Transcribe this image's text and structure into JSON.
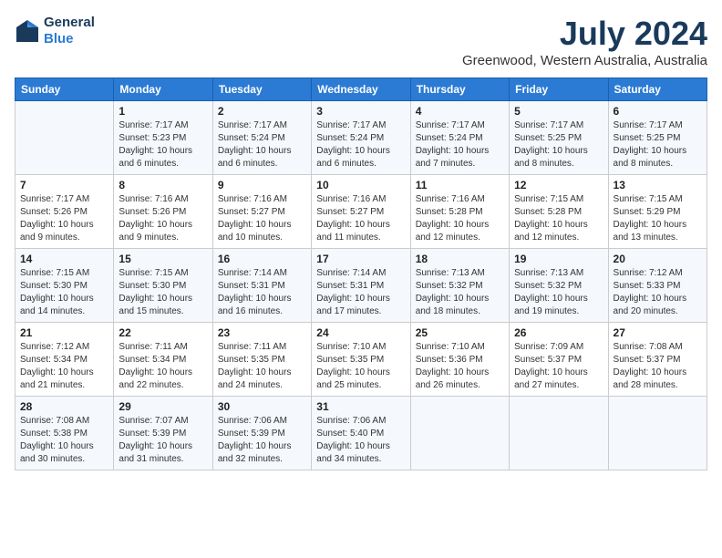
{
  "header": {
    "logo_line1": "General",
    "logo_line2": "Blue",
    "month": "July 2024",
    "location": "Greenwood, Western Australia, Australia"
  },
  "weekdays": [
    "Sunday",
    "Monday",
    "Tuesday",
    "Wednesday",
    "Thursday",
    "Friday",
    "Saturday"
  ],
  "weeks": [
    [
      {
        "day": "",
        "info": ""
      },
      {
        "day": "1",
        "info": "Sunrise: 7:17 AM\nSunset: 5:23 PM\nDaylight: 10 hours\nand 6 minutes."
      },
      {
        "day": "2",
        "info": "Sunrise: 7:17 AM\nSunset: 5:24 PM\nDaylight: 10 hours\nand 6 minutes."
      },
      {
        "day": "3",
        "info": "Sunrise: 7:17 AM\nSunset: 5:24 PM\nDaylight: 10 hours\nand 6 minutes."
      },
      {
        "day": "4",
        "info": "Sunrise: 7:17 AM\nSunset: 5:24 PM\nDaylight: 10 hours\nand 7 minutes."
      },
      {
        "day": "5",
        "info": "Sunrise: 7:17 AM\nSunset: 5:25 PM\nDaylight: 10 hours\nand 8 minutes."
      },
      {
        "day": "6",
        "info": "Sunrise: 7:17 AM\nSunset: 5:25 PM\nDaylight: 10 hours\nand 8 minutes."
      }
    ],
    [
      {
        "day": "7",
        "info": "Sunrise: 7:17 AM\nSunset: 5:26 PM\nDaylight: 10 hours\nand 9 minutes."
      },
      {
        "day": "8",
        "info": "Sunrise: 7:16 AM\nSunset: 5:26 PM\nDaylight: 10 hours\nand 9 minutes."
      },
      {
        "day": "9",
        "info": "Sunrise: 7:16 AM\nSunset: 5:27 PM\nDaylight: 10 hours\nand 10 minutes."
      },
      {
        "day": "10",
        "info": "Sunrise: 7:16 AM\nSunset: 5:27 PM\nDaylight: 10 hours\nand 11 minutes."
      },
      {
        "day": "11",
        "info": "Sunrise: 7:16 AM\nSunset: 5:28 PM\nDaylight: 10 hours\nand 12 minutes."
      },
      {
        "day": "12",
        "info": "Sunrise: 7:15 AM\nSunset: 5:28 PM\nDaylight: 10 hours\nand 12 minutes."
      },
      {
        "day": "13",
        "info": "Sunrise: 7:15 AM\nSunset: 5:29 PM\nDaylight: 10 hours\nand 13 minutes."
      }
    ],
    [
      {
        "day": "14",
        "info": "Sunrise: 7:15 AM\nSunset: 5:30 PM\nDaylight: 10 hours\nand 14 minutes."
      },
      {
        "day": "15",
        "info": "Sunrise: 7:15 AM\nSunset: 5:30 PM\nDaylight: 10 hours\nand 15 minutes."
      },
      {
        "day": "16",
        "info": "Sunrise: 7:14 AM\nSunset: 5:31 PM\nDaylight: 10 hours\nand 16 minutes."
      },
      {
        "day": "17",
        "info": "Sunrise: 7:14 AM\nSunset: 5:31 PM\nDaylight: 10 hours\nand 17 minutes."
      },
      {
        "day": "18",
        "info": "Sunrise: 7:13 AM\nSunset: 5:32 PM\nDaylight: 10 hours\nand 18 minutes."
      },
      {
        "day": "19",
        "info": "Sunrise: 7:13 AM\nSunset: 5:32 PM\nDaylight: 10 hours\nand 19 minutes."
      },
      {
        "day": "20",
        "info": "Sunrise: 7:12 AM\nSunset: 5:33 PM\nDaylight: 10 hours\nand 20 minutes."
      }
    ],
    [
      {
        "day": "21",
        "info": "Sunrise: 7:12 AM\nSunset: 5:34 PM\nDaylight: 10 hours\nand 21 minutes."
      },
      {
        "day": "22",
        "info": "Sunrise: 7:11 AM\nSunset: 5:34 PM\nDaylight: 10 hours\nand 22 minutes."
      },
      {
        "day": "23",
        "info": "Sunrise: 7:11 AM\nSunset: 5:35 PM\nDaylight: 10 hours\nand 24 minutes."
      },
      {
        "day": "24",
        "info": "Sunrise: 7:10 AM\nSunset: 5:35 PM\nDaylight: 10 hours\nand 25 minutes."
      },
      {
        "day": "25",
        "info": "Sunrise: 7:10 AM\nSunset: 5:36 PM\nDaylight: 10 hours\nand 26 minutes."
      },
      {
        "day": "26",
        "info": "Sunrise: 7:09 AM\nSunset: 5:37 PM\nDaylight: 10 hours\nand 27 minutes."
      },
      {
        "day": "27",
        "info": "Sunrise: 7:08 AM\nSunset: 5:37 PM\nDaylight: 10 hours\nand 28 minutes."
      }
    ],
    [
      {
        "day": "28",
        "info": "Sunrise: 7:08 AM\nSunset: 5:38 PM\nDaylight: 10 hours\nand 30 minutes."
      },
      {
        "day": "29",
        "info": "Sunrise: 7:07 AM\nSunset: 5:39 PM\nDaylight: 10 hours\nand 31 minutes."
      },
      {
        "day": "30",
        "info": "Sunrise: 7:06 AM\nSunset: 5:39 PM\nDaylight: 10 hours\nand 32 minutes."
      },
      {
        "day": "31",
        "info": "Sunrise: 7:06 AM\nSunset: 5:40 PM\nDaylight: 10 hours\nand 34 minutes."
      },
      {
        "day": "",
        "info": ""
      },
      {
        "day": "",
        "info": ""
      },
      {
        "day": "",
        "info": ""
      }
    ]
  ]
}
